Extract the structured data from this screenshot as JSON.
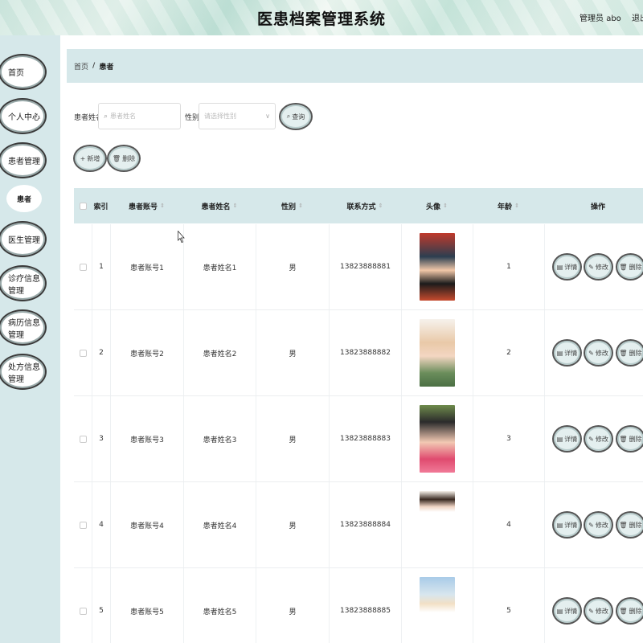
{
  "header": {
    "title": "医患档案管理系统",
    "user_role": "管理员 abo",
    "logout_label": "退出"
  },
  "sidebar": {
    "items": [
      {
        "label": "首页",
        "has_chevron": false
      },
      {
        "label": "个人中心",
        "has_chevron": true
      },
      {
        "label": "患者管理",
        "has_chevron": true
      },
      {
        "label": "医生管理",
        "has_chevron": true
      },
      {
        "label": "诊疗信息管理",
        "has_chevron": false
      },
      {
        "label": "病历信息管理",
        "has_chevron": false
      },
      {
        "label": "处方信息管理",
        "has_chevron": false
      }
    ],
    "active_subitem": "患者"
  },
  "breadcrumb": {
    "home": "首页",
    "separator": "/",
    "current": "患者"
  },
  "search": {
    "name_label": "患者姓名",
    "name_placeholder": "患者姓名",
    "gender_label": "性别",
    "gender_placeholder": "请选择性别",
    "query_label": "查询"
  },
  "toolbar": {
    "add_label": "新增",
    "delete_label": "删除"
  },
  "table": {
    "columns": [
      "索引",
      "患者账号",
      "患者姓名",
      "性别",
      "联系方式",
      "头像",
      "年龄",
      "操作"
    ],
    "actions": {
      "detail": "详情",
      "edit": "修改",
      "delete": "删除"
    },
    "rows": [
      {
        "index": "1",
        "account": "患者账号1",
        "name": "患者姓名1",
        "gender": "男",
        "phone": "13823888881",
        "age": "1"
      },
      {
        "index": "2",
        "account": "患者账号2",
        "name": "患者姓名2",
        "gender": "男",
        "phone": "13823888882",
        "age": "2"
      },
      {
        "index": "3",
        "account": "患者账号3",
        "name": "患者姓名3",
        "gender": "男",
        "phone": "13823888883",
        "age": "3"
      },
      {
        "index": "4",
        "account": "患者账号4",
        "name": "患者姓名4",
        "gender": "男",
        "phone": "13823888884",
        "age": "4"
      },
      {
        "index": "5",
        "account": "患者账号5",
        "name": "患者姓名5",
        "gender": "男",
        "phone": "13823888885",
        "age": "5"
      }
    ]
  },
  "colors": {
    "accent_bg": "#d6e8ea",
    "button_bg": "#e4efef"
  }
}
